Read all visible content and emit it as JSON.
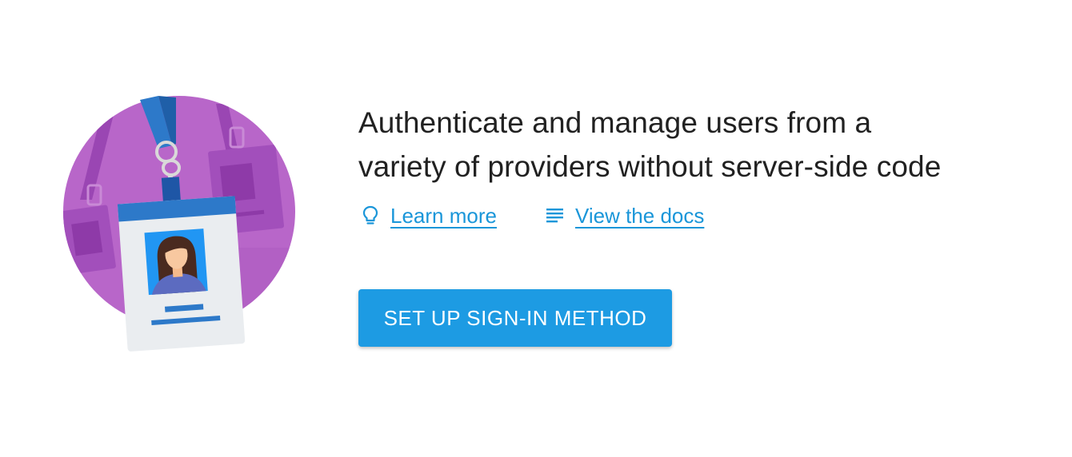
{
  "hero": {
    "headline_line1": "Authenticate and manage users from a",
    "headline_line2": "variety of providers without server-side code"
  },
  "links": {
    "learn_more": {
      "label": "Learn more",
      "icon": "lightbulb-icon"
    },
    "view_docs": {
      "label": "View the docs",
      "icon": "document-lines-icon"
    }
  },
  "cta": {
    "label": "SET UP SIGN-IN METHOD"
  },
  "colors": {
    "primary": "#1d9be3",
    "link": "#1a96d9",
    "circle": "#b25fc7",
    "text": "#212121"
  },
  "illustration": {
    "icon": "id-badge-illustration"
  }
}
